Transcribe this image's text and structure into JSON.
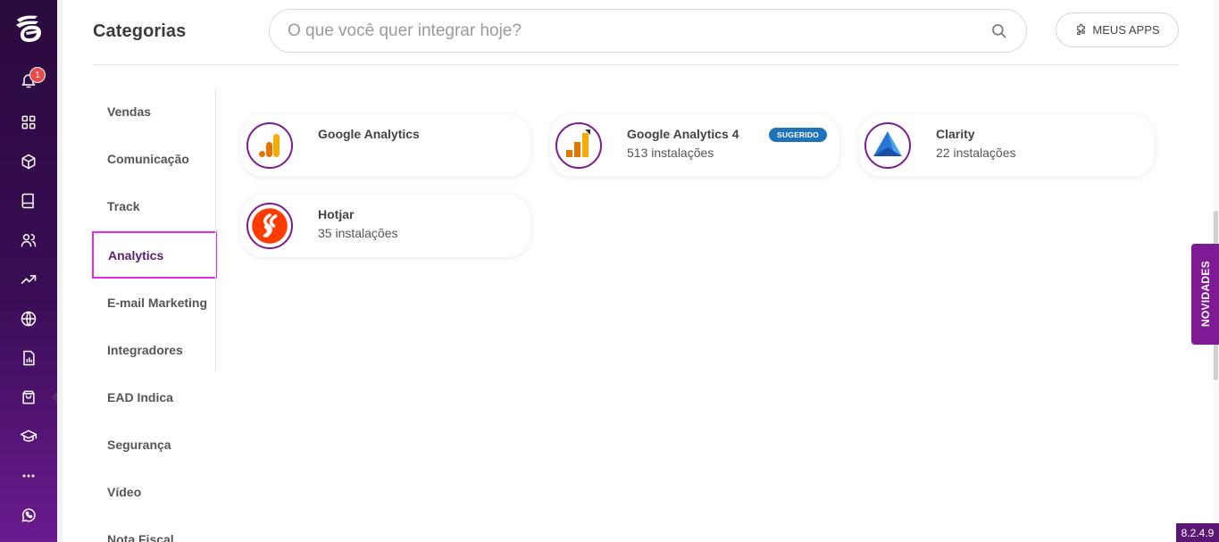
{
  "rail": {
    "notification_count": "1"
  },
  "header": {
    "title": "Categorias",
    "search_placeholder": "O que você quer integrar hoje?",
    "my_apps_label": "MEUS APPS"
  },
  "categories": [
    {
      "label": "Vendas"
    },
    {
      "label": "Comunicação"
    },
    {
      "label": "Track"
    },
    {
      "label": "Analytics",
      "selected": true
    },
    {
      "label": "E-mail Marketing"
    },
    {
      "label": "Integradores"
    },
    {
      "label": "EAD Indica"
    },
    {
      "label": "Segurança"
    },
    {
      "label": "Vídeo"
    },
    {
      "label": "Nota Fiscal"
    }
  ],
  "apps": [
    {
      "name": "Google Analytics",
      "installs": "",
      "icon": "google-analytics-icon"
    },
    {
      "name": "Google Analytics 4",
      "installs": "513 instalações",
      "tag": "SUGERIDO",
      "icon": "google-analytics-4-icon"
    },
    {
      "name": "Clarity",
      "installs": "22 instalações",
      "icon": "clarity-icon"
    },
    {
      "name": "Hotjar",
      "installs": "35 instalações",
      "icon": "hotjar-icon"
    }
  ],
  "novidades_label": "NOVIDADES",
  "version": "8.2.4.9",
  "colors": {
    "rail_top": "#2a0a3d",
    "rail_bottom": "#6a1b8f",
    "accent_purple": "#7b1d8f",
    "selection_border": "#e52ee5",
    "tag_blue": "#1f74b9"
  }
}
